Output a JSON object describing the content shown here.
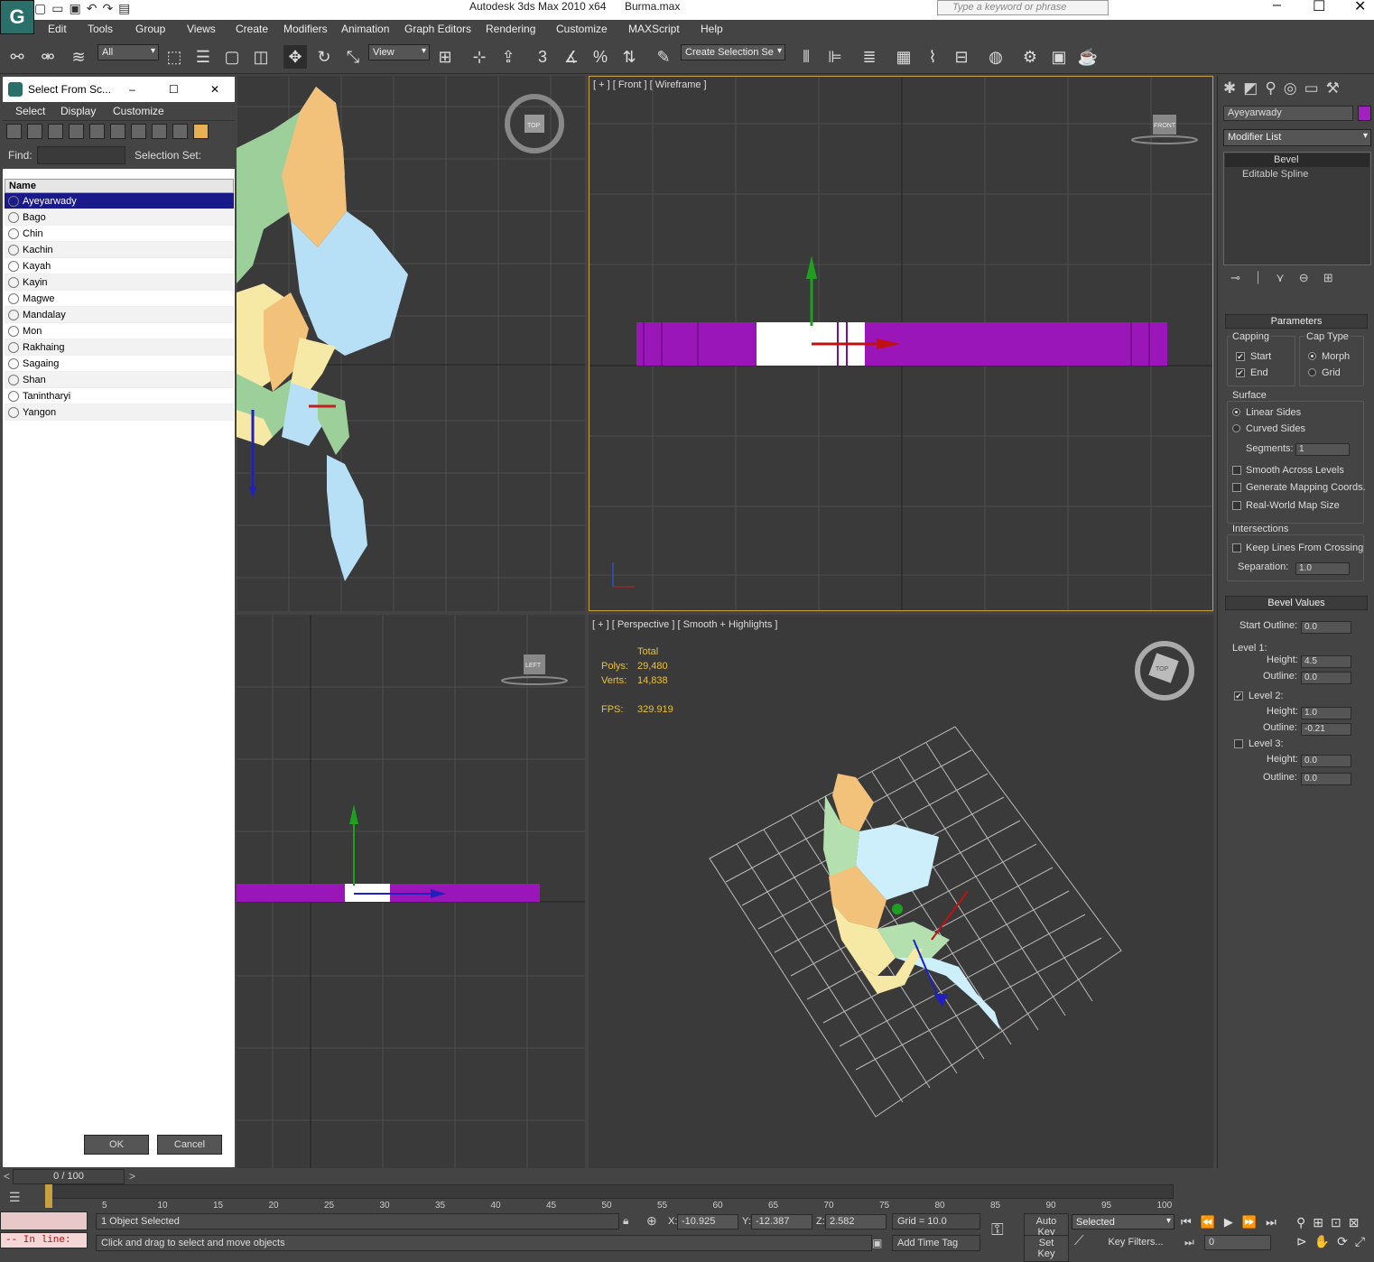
{
  "app": {
    "title": "Autodesk 3ds Max  2010 x64",
    "file": "Burma.max",
    "search_placeholder": "Type a keyword or phrase"
  },
  "menu": [
    "Edit",
    "Tools",
    "Group",
    "Views",
    "Create",
    "Modifiers",
    "Animation",
    "Graph Editors",
    "Rendering",
    "Customize",
    "MAXScript",
    "Help"
  ],
  "toolbar": {
    "filter": "All",
    "ref_coord": "View",
    "selection_set": "Create Selection Se"
  },
  "dialog": {
    "title": "Select From Sc...",
    "menu": [
      "Select",
      "Display",
      "Customize"
    ],
    "find_label": "Find:",
    "selset_label": "Selection Set:",
    "col_name": "Name",
    "items": [
      "Ayeyarwady",
      "Bago",
      "Chin",
      "Kachin",
      "Kayah",
      "Kayin",
      "Magwe",
      "Mandalay",
      "Mon",
      "Rakhaing",
      "Sagaing",
      "Shan",
      "Tanintharyi",
      "Yangon"
    ],
    "ok": "OK",
    "cancel": "Cancel"
  },
  "viewports": {
    "front_label": "[ + ] [ Front ] [ Wireframe ]",
    "persp_label": "[ + ] [ Perspective ] [ Smooth + Highlights ]",
    "stats": {
      "total": "Total",
      "polys_label": "Polys:",
      "polys": "29,480",
      "verts_label": "Verts:",
      "verts": "14,838",
      "fps_label": "FPS:",
      "fps": "329.919"
    },
    "cube_top": "TOP",
    "cube_front": "FRONT",
    "cube_left": "LEFT"
  },
  "panel": {
    "object_name": "Ayeyarwady",
    "object_color": "#a020c0",
    "modifier_list": "Modifier List",
    "stack": [
      "Bevel",
      "Editable Spline"
    ],
    "parameters": "Parameters",
    "capping": "Capping",
    "cap_start": "Start",
    "cap_end": "End",
    "cap_type": "Cap Type",
    "morph": "Morph",
    "grid": "Grid",
    "surface": "Surface",
    "linear": "Linear Sides",
    "curved": "Curved Sides",
    "segments_label": "Segments:",
    "segments": "1",
    "smooth_levels": "Smooth Across Levels",
    "gen_mapping": "Generate Mapping Coords.",
    "realworld": "Real-World Map Size",
    "intersections": "Intersections",
    "keep_lines": "Keep Lines From Crossing",
    "separation_label": "Separation:",
    "separation": "1.0",
    "bevel_values": "Bevel Values",
    "start_outline_label": "Start Outline:",
    "start_outline": "0.0",
    "level1": "Level 1:",
    "height_label": "Height:",
    "outline_label": "Outline:",
    "l1_height": "4.5",
    "l1_outline": "0.0",
    "level2": "Level 2:",
    "l2_height": "1.0",
    "l2_outline": "-0.21",
    "level3": "Level 3:",
    "l3_height": "0.0",
    "l3_outline": "0.0"
  },
  "timeline": {
    "frame": "0 / 100",
    "ticks": [
      "5",
      "10",
      "15",
      "20",
      "25",
      "30",
      "35",
      "40",
      "45",
      "50",
      "55",
      "60",
      "65",
      "70",
      "75",
      "80",
      "85",
      "90",
      "95",
      "100"
    ]
  },
  "status": {
    "inline": "-- In line:",
    "selected": "1 Object Selected",
    "prompt": "Click and drag to select and move objects",
    "x_label": "X:",
    "x": "-10.925",
    "y_label": "Y:",
    "y": "-12.387",
    "z_label": "Z:",
    "z": "2.582",
    "grid": "Grid = 10.0",
    "auto_key": "Auto Key",
    "set_key": "Set Key",
    "key_mode": "Selected",
    "key_filters": "Key Filters...",
    "add_time_tag": "Add Time Tag",
    "cur_frame": "0"
  }
}
